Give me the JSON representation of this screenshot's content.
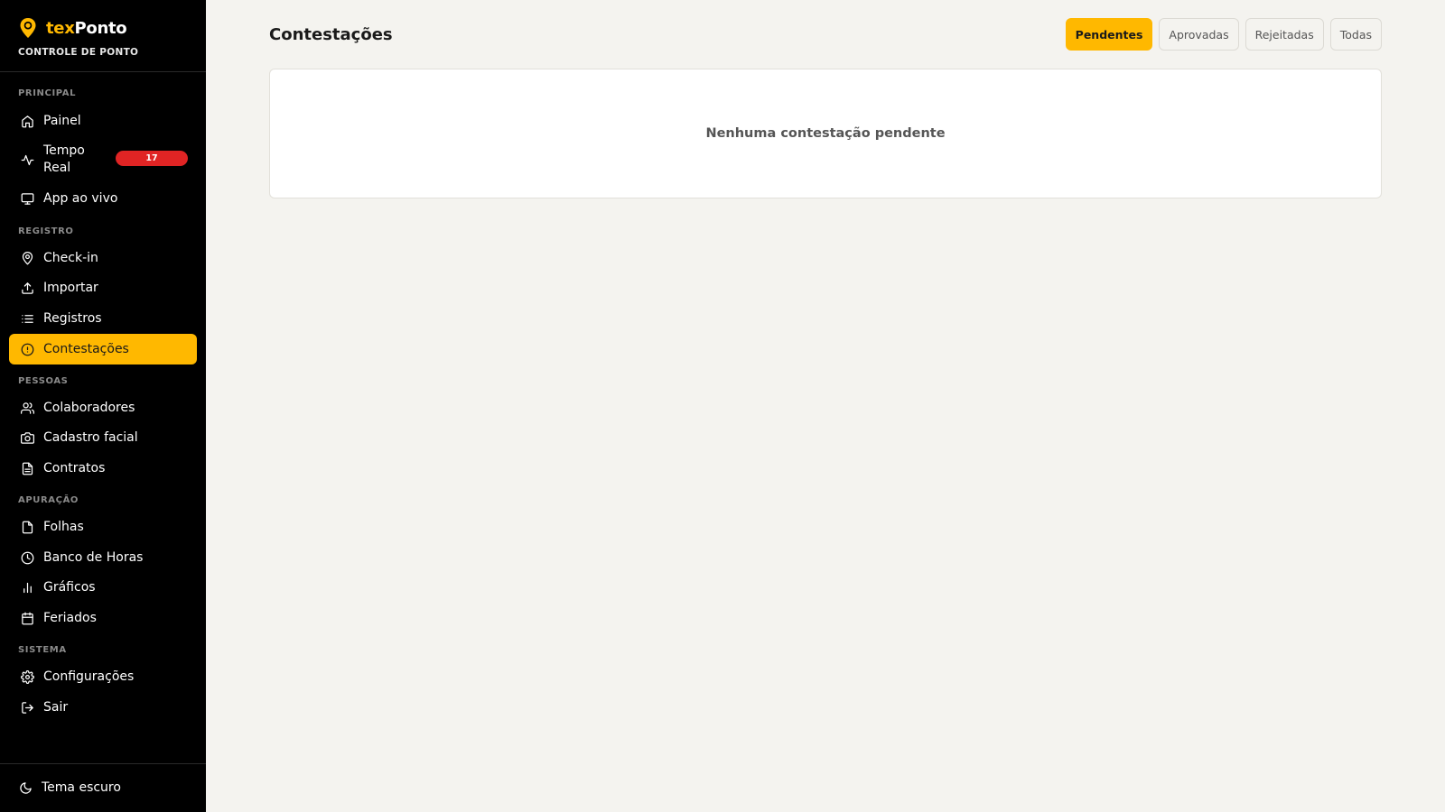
{
  "brand": {
    "name_prefix": "tex",
    "name_suffix": "Ponto",
    "subtitle": "CONTROLE DE PONTO"
  },
  "sidebar": {
    "sections": [
      {
        "label": "PRINCIPAL"
      },
      {
        "label": "REGISTRO"
      },
      {
        "label": "PESSOAS"
      },
      {
        "label": "APURAÇÃO"
      },
      {
        "label": "SISTEMA"
      }
    ],
    "items": {
      "painel": "Painel",
      "tempo_real": "Tempo Real",
      "tempo_real_badge": "17",
      "app_ao_vivo": "App ao vivo",
      "check_in": "Check-in",
      "importar": "Importar",
      "registros": "Registros",
      "contestacoes": "Contestações",
      "colaboradores": "Colaboradores",
      "cadastro_facial": "Cadastro facial",
      "contratos": "Contratos",
      "folhas": "Folhas",
      "banco_de_horas": "Banco de Horas",
      "graficos": "Gráficos",
      "feriados": "Feriados",
      "configuracoes": "Configurações",
      "sair": "Sair"
    },
    "footer": {
      "theme_toggle": "Tema escuro"
    },
    "active_item": "contestacoes"
  },
  "main": {
    "title": "Contestações",
    "filters": [
      "Pendentes",
      "Aprovadas",
      "Rejeitadas",
      "Todas"
    ],
    "active_filter": "Pendentes",
    "empty_message": "Nenhuma contestação pendente"
  },
  "colors": {
    "accent": "#ffb800",
    "sidebar_bg": "#000000",
    "badge": "#e02424",
    "page_bg": "#f4f3ef"
  }
}
